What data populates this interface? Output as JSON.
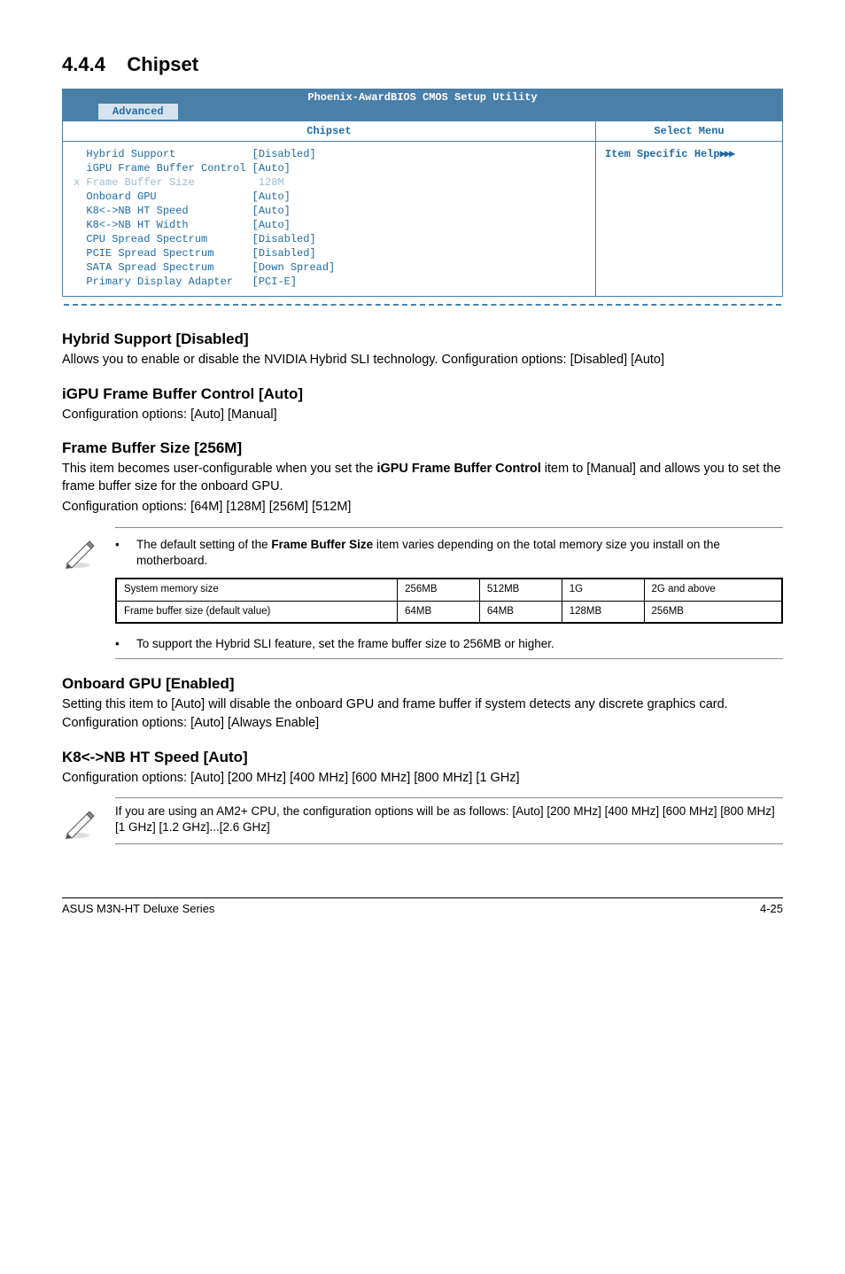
{
  "section": {
    "number": "4.4.4",
    "title": "Chipset"
  },
  "bios": {
    "title": "Phoenix-AwardBIOS CMOS Setup Utility",
    "tab": "Advanced",
    "left_header": "Chipset",
    "right_header": "Select Menu",
    "right_body": "Item Specific Help",
    "lines": [
      {
        "mark": " ",
        "label": "Hybrid Support",
        "value": "[Disabled]",
        "dim": false
      },
      {
        "mark": " ",
        "label": "iGPU Frame Buffer Control",
        "value": "[Auto]",
        "dim": false
      },
      {
        "mark": "x",
        "label": "Frame Buffer Size",
        "value": " 128M",
        "dim": true
      },
      {
        "mark": " ",
        "label": "Onboard GPU",
        "value": "[Auto]",
        "dim": false
      },
      {
        "mark": " ",
        "label": "K8<->NB HT Speed",
        "value": "[Auto]",
        "dim": false
      },
      {
        "mark": " ",
        "label": "K8<->NB HT Width",
        "value": "[Auto]",
        "dim": false
      },
      {
        "mark": " ",
        "label": "CPU Spread Spectrum",
        "value": "[Disabled]",
        "dim": false
      },
      {
        "mark": " ",
        "label": "PCIE Spread Spectrum",
        "value": "[Disabled]",
        "dim": false
      },
      {
        "mark": " ",
        "label": "SATA Spread Spectrum",
        "value": "[Down Spread]",
        "dim": false
      },
      {
        "mark": " ",
        "label": "Primary Display Adapter",
        "value": "[PCI-E]",
        "dim": false
      }
    ],
    "arrows": "▶▶▶"
  },
  "options": {
    "hybrid": {
      "title": "Hybrid Support [Disabled]",
      "text": "Allows you to enable or disable the NVIDIA Hybrid SLI technology. Configuration options: [Disabled] [Auto]"
    },
    "igpu": {
      "title": "iGPU Frame Buffer Control [Auto]",
      "text": "Configuration options: [Auto] [Manual]"
    },
    "fbs": {
      "title": "Frame Buffer Size [256M]",
      "text1_a": "This item becomes user-configurable when you set the ",
      "text1_bold": "iGPU Frame Buffer Control",
      "text1_b": " item to [Manual] and allows you to set the frame buffer size for the onboard GPU.",
      "text2": "Configuration options: [64M] [128M] [256M] [512M]",
      "note1_a": "The default setting of the ",
      "note1_bold": "Frame Buffer Size",
      "note1_b": " item varies depending on the total memory size you install on the motherboard.",
      "note2": "To support the Hybrid SLI feature, set the frame buffer size to 256MB or higher."
    },
    "onboard": {
      "title": "Onboard GPU [Enabled]",
      "text": "Setting this item to [Auto] will disable the onboard GPU and frame buffer if system detects any discrete graphics card.",
      "text2": "Configuration options: [Auto] [Always Enable]"
    },
    "k8speed": {
      "title": "K8<->NB HT Speed [Auto]",
      "text": "Configuration options: [Auto] [200 MHz] [400 MHz] [600 MHz] [800 MHz] [1 GHz]",
      "note": "If you are using an AM2+ CPU, the configuration options will be as follows: [Auto] [200 MHz] [400 MHz] [600 MHz] [800 MHz] [1 GHz] [1.2 GHz]...[2.6 GHz]"
    }
  },
  "mem_table": {
    "row1": [
      "System memory size",
      "256MB",
      "512MB",
      "1G",
      "2G and above"
    ],
    "row2": [
      "Frame buffer size (default value)",
      "64MB",
      "64MB",
      "128MB",
      "256MB"
    ]
  },
  "footer": {
    "left": "ASUS M3N-HT Deluxe Series",
    "right": "4-25"
  }
}
